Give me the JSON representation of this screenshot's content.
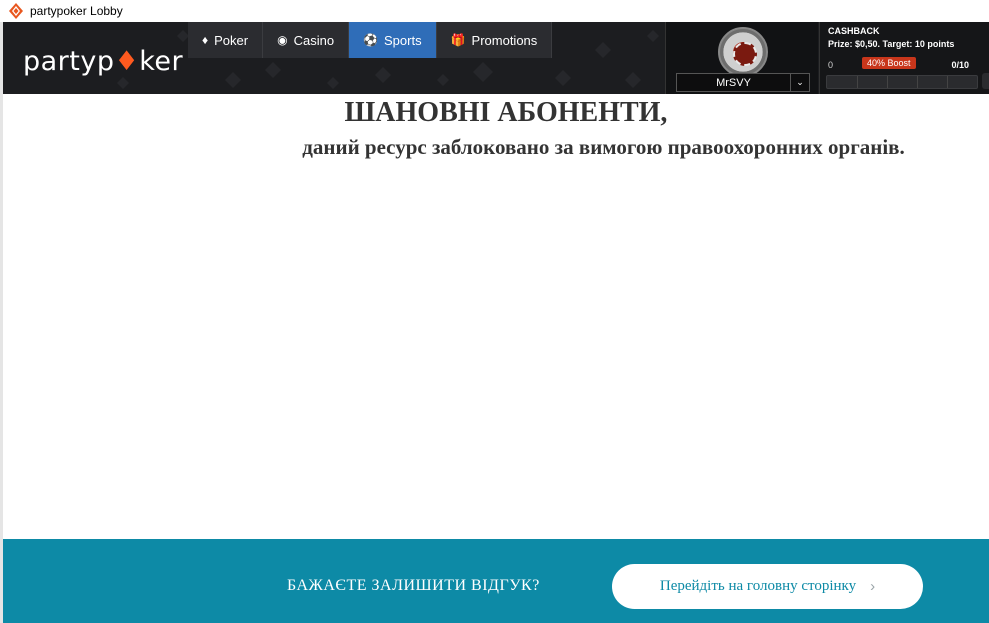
{
  "window": {
    "title": "partypoker Lobby"
  },
  "header": {
    "logo": {
      "part1": "party",
      "p": "p",
      "ace": "♦",
      "part2": "ker"
    },
    "nav": [
      {
        "label": "Poker",
        "icon": "spade-diamond-icon",
        "glyph": "♦"
      },
      {
        "label": "Casino",
        "icon": "casino-chip-icon",
        "glyph": "◉"
      },
      {
        "label": "Sports",
        "icon": "soccer-ball-icon",
        "glyph": "⚽",
        "active": true
      },
      {
        "label": "Promotions",
        "icon": "gift-icon",
        "glyph": "🎁"
      }
    ],
    "user": {
      "name": "MrSVY",
      "chevron": "⌄"
    },
    "cashback": {
      "title": "CASHBACK",
      "prize": "Prize: $0,50. Target: 10 points",
      "min": "0",
      "boost": "40% Boost",
      "progress": "0/10"
    }
  },
  "main": {
    "headline": "ШАНОВНІ АБОНЕНТИ,",
    "subline": "даний ресурс заблоковано за вимогою правоохоронних органів."
  },
  "footer": {
    "feedback_text": "БАЖАЄТЕ ЗАЛИШИТИ ВІДГУК?",
    "home_button": "Перейдіть на головну сторінку",
    "home_chevron": "›"
  },
  "colors": {
    "header_bg": "#1c1d20",
    "nav_active": "#2f6db8",
    "brand_orange": "#ff5a1f",
    "boost_red": "#c8361b",
    "footer_bg": "#0d8aa6",
    "text_dark": "#333333"
  }
}
